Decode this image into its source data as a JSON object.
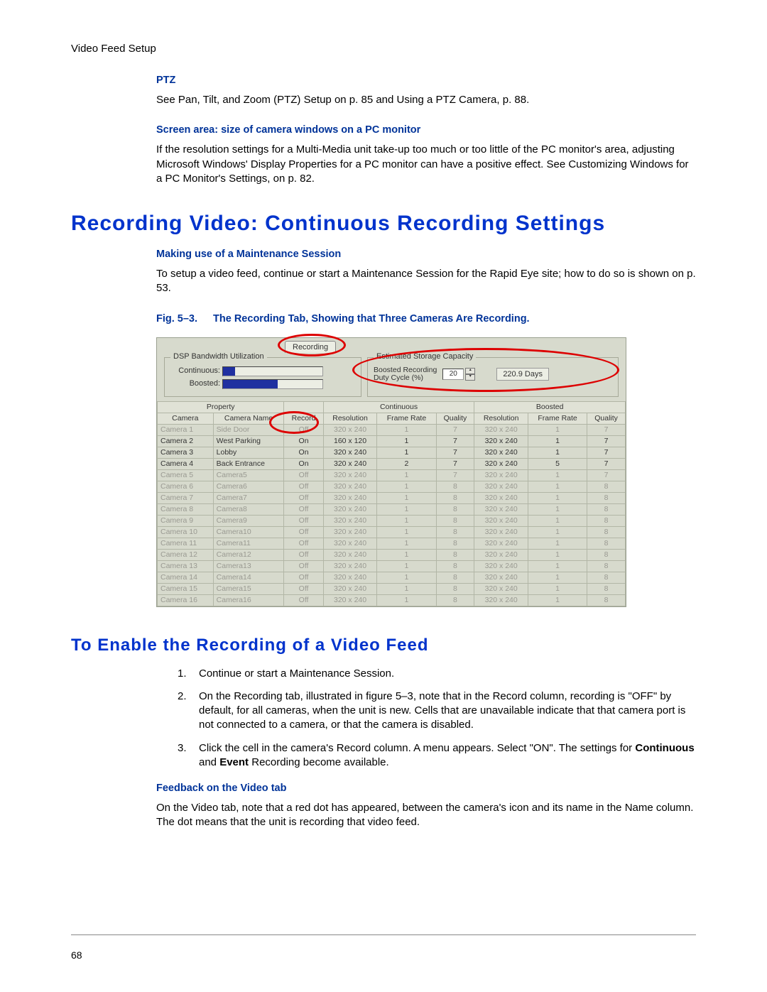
{
  "header": "Video Feed Setup",
  "page_num": "68",
  "ptz": {
    "title": "PTZ",
    "text": "See Pan, Tilt, and Zoom (PTZ) Setup on p. 85 and Using a PTZ Camera, p. 88."
  },
  "screen_area": {
    "title": "Screen area: size of camera windows on a PC monitor",
    "text": "If the resolution settings for a Multi-Media unit take-up too much or too little of the PC monitor's area, adjusting Microsoft Windows' Display Properties for a PC monitor can have a positive effect. See Customizing Windows for a PC Monitor's Settings, on p. 82."
  },
  "main_heading": "Recording Video: Continuous Recording Settings",
  "maint": {
    "title": "Making use of a Maintenance Session",
    "text": "To setup a video feed, continue or start a Maintenance Session for the Rapid Eye site; how to do so is shown on p. 53."
  },
  "fig": {
    "label": "Fig. 5–3.",
    "desc": "The Recording Tab, Showing that Three Cameras Are Recording."
  },
  "panel": {
    "tab": "Recording",
    "bw_group": "DSP Bandwidth Utilization",
    "continuous_lbl": "Continuous:",
    "boosted_lbl": "Boosted:",
    "est_group": "Estimated Storage Capacity",
    "duty_lbl1": "Boosted Recording",
    "duty_lbl2": "Duty Cycle (%)",
    "duty_val": "20",
    "days": "220.9 Days",
    "hdr_property": "Property",
    "hdr_continuous": "Continuous",
    "hdr_boosted": "Boosted",
    "cols": {
      "camera": "Camera",
      "name": "Camera Name",
      "record": "Record",
      "res": "Resolution",
      "fr": "Frame Rate",
      "q": "Quality"
    },
    "rows": [
      {
        "cam": "Camera 1",
        "name": "Side Door",
        "rec": "Off",
        "cres": "320 x 240",
        "cfr": "1",
        "cq": "7",
        "bres": "320 x 240",
        "bfr": "1",
        "bq": "7",
        "dis": true
      },
      {
        "cam": "Camera 2",
        "name": "West Parking",
        "rec": "On",
        "cres": "160 x 120",
        "cfr": "1",
        "cq": "7",
        "bres": "320 x 240",
        "bfr": "1",
        "bq": "7",
        "dis": false
      },
      {
        "cam": "Camera 3",
        "name": "Lobby",
        "rec": "On",
        "cres": "320 x 240",
        "cfr": "1",
        "cq": "7",
        "bres": "320 x 240",
        "bfr": "1",
        "bq": "7",
        "dis": false
      },
      {
        "cam": "Camera 4",
        "name": "Back Entrance",
        "rec": "On",
        "cres": "320 x 240",
        "cfr": "2",
        "cq": "7",
        "bres": "320 x 240",
        "bfr": "5",
        "bq": "7",
        "dis": false
      },
      {
        "cam": "Camera 5",
        "name": "Camera5",
        "rec": "Off",
        "cres": "320 x 240",
        "cfr": "1",
        "cq": "7",
        "bres": "320 x 240",
        "bfr": "1",
        "bq": "7",
        "dis": true
      },
      {
        "cam": "Camera 6",
        "name": "Camera6",
        "rec": "Off",
        "cres": "320 x 240",
        "cfr": "1",
        "cq": "8",
        "bres": "320 x 240",
        "bfr": "1",
        "bq": "8",
        "dis": true
      },
      {
        "cam": "Camera 7",
        "name": "Camera7",
        "rec": "Off",
        "cres": "320 x 240",
        "cfr": "1",
        "cq": "8",
        "bres": "320 x 240",
        "bfr": "1",
        "bq": "8",
        "dis": true
      },
      {
        "cam": "Camera 8",
        "name": "Camera8",
        "rec": "Off",
        "cres": "320 x 240",
        "cfr": "1",
        "cq": "8",
        "bres": "320 x 240",
        "bfr": "1",
        "bq": "8",
        "dis": true
      },
      {
        "cam": "Camera 9",
        "name": "Camera9",
        "rec": "Off",
        "cres": "320 x 240",
        "cfr": "1",
        "cq": "8",
        "bres": "320 x 240",
        "bfr": "1",
        "bq": "8",
        "dis": true
      },
      {
        "cam": "Camera 10",
        "name": "Camera10",
        "rec": "Off",
        "cres": "320 x 240",
        "cfr": "1",
        "cq": "8",
        "bres": "320 x 240",
        "bfr": "1",
        "bq": "8",
        "dis": true
      },
      {
        "cam": "Camera 11",
        "name": "Camera11",
        "rec": "Off",
        "cres": "320 x 240",
        "cfr": "1",
        "cq": "8",
        "bres": "320 x 240",
        "bfr": "1",
        "bq": "8",
        "dis": true
      },
      {
        "cam": "Camera 12",
        "name": "Camera12",
        "rec": "Off",
        "cres": "320 x 240",
        "cfr": "1",
        "cq": "8",
        "bres": "320 x 240",
        "bfr": "1",
        "bq": "8",
        "dis": true
      },
      {
        "cam": "Camera 13",
        "name": "Camera13",
        "rec": "Off",
        "cres": "320 x 240",
        "cfr": "1",
        "cq": "8",
        "bres": "320 x 240",
        "bfr": "1",
        "bq": "8",
        "dis": true
      },
      {
        "cam": "Camera 14",
        "name": "Camera14",
        "rec": "Off",
        "cres": "320 x 240",
        "cfr": "1",
        "cq": "8",
        "bres": "320 x 240",
        "bfr": "1",
        "bq": "8",
        "dis": true
      },
      {
        "cam": "Camera 15",
        "name": "Camera15",
        "rec": "Off",
        "cres": "320 x 240",
        "cfr": "1",
        "cq": "8",
        "bres": "320 x 240",
        "bfr": "1",
        "bq": "8",
        "dis": true
      },
      {
        "cam": "Camera 16",
        "name": "Camera16",
        "rec": "Off",
        "cres": "320 x 240",
        "cfr": "1",
        "cq": "8",
        "bres": "320 x 240",
        "bfr": "1",
        "bq": "8",
        "dis": true
      }
    ]
  },
  "sub_heading": "To Enable the Recording of a Video Feed",
  "steps": [
    "Continue or start a Maintenance Session.",
    "On the Recording tab, illustrated in figure 5–3, note that in the Record column, recording is \"OFF\" by default, for all cameras, when the unit is new. Cells that are unavailable indicate that that camera port is not connected to a camera, or that the camera is disabled.",
    "Click the cell in the camera's Record column. A menu appears. Select \"ON\". The settings for Continuous and Event Recording become available."
  ],
  "step3_html": "Click the cell in the camera's Record column. A menu appears. Select \"ON\". The settings for <b>Continuous</b> and <b>Event</b> Recording become available.",
  "feedback": {
    "title": "Feedback on the Video tab",
    "text": "On the Video tab, note that a red dot has appeared, between the camera's icon and its name in the Name column. The dot means that the unit is recording that video feed."
  }
}
